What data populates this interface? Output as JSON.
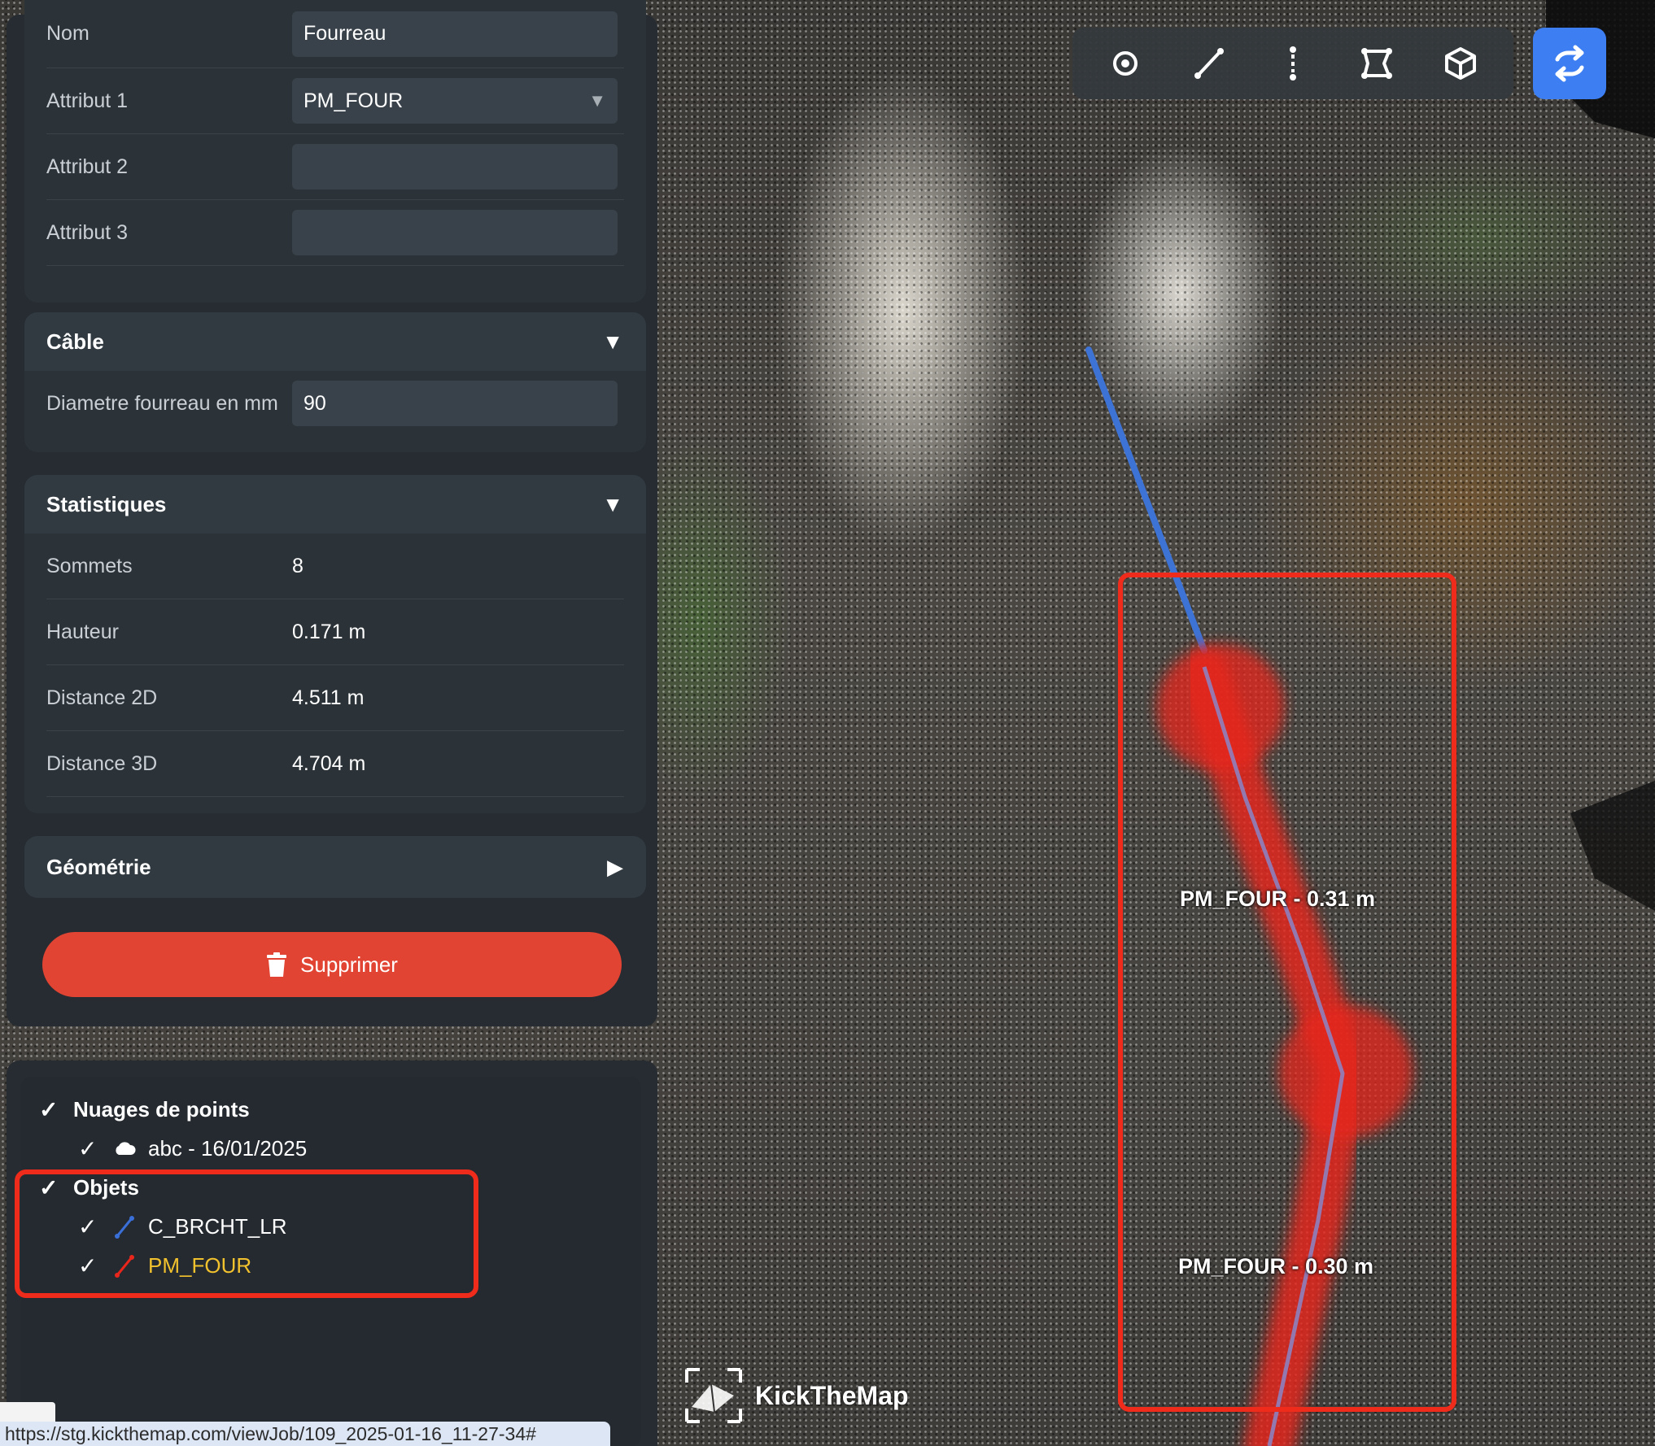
{
  "properties": {
    "fields": [
      {
        "label": "Nom",
        "value": "Fourreau"
      },
      {
        "label": "Attribut 1",
        "value": "PM_FOUR"
      },
      {
        "label": "Attribut 2",
        "value": ""
      },
      {
        "label": "Attribut 3",
        "value": ""
      }
    ],
    "cable": {
      "title": "Câble",
      "diameter_label": "Diametre fourreau en mm",
      "diameter_value": "90"
    },
    "stats": {
      "title": "Statistiques",
      "rows": [
        {
          "label": "Sommets",
          "value": "8"
        },
        {
          "label": "Hauteur",
          "value": "0.171 m"
        },
        {
          "label": "Distance 2D",
          "value": "4.511 m"
        },
        {
          "label": "Distance 3D",
          "value": "4.704 m"
        }
      ]
    },
    "geometry": {
      "title": "Géométrie"
    },
    "delete_label": "Supprimer"
  },
  "layers": {
    "point_clouds": {
      "label": "Nuages de points",
      "items": [
        {
          "label": "abc - 16/01/2025",
          "icon": "cloud-icon"
        }
      ]
    },
    "objects": {
      "label": "Objets",
      "items": [
        {
          "label": "C_BRCHT_LR",
          "color": "#3a6fd8"
        },
        {
          "label": "PM_FOUR",
          "color": "#e8261c",
          "text_color": "#f2c12e"
        }
      ]
    }
  },
  "viewport": {
    "labels": [
      "PM_FOUR - 0.31 m",
      "PM_FOUR - 0.30 m"
    ],
    "logo_text": "KickTheMap"
  },
  "toolbar": {
    "tools": [
      "point-tool-icon",
      "line-tool-icon",
      "vertical-tool-icon",
      "polygon-tool-icon",
      "volume-tool-icon"
    ],
    "sync": "sync-icon"
  },
  "status_url": "https://stg.kickthemap.com/viewJob/109_2025-01-16_11-27-34#",
  "colors": {
    "accent": "#3d7ff2",
    "danger": "#e24433",
    "highlight": "#ef2b1c"
  }
}
